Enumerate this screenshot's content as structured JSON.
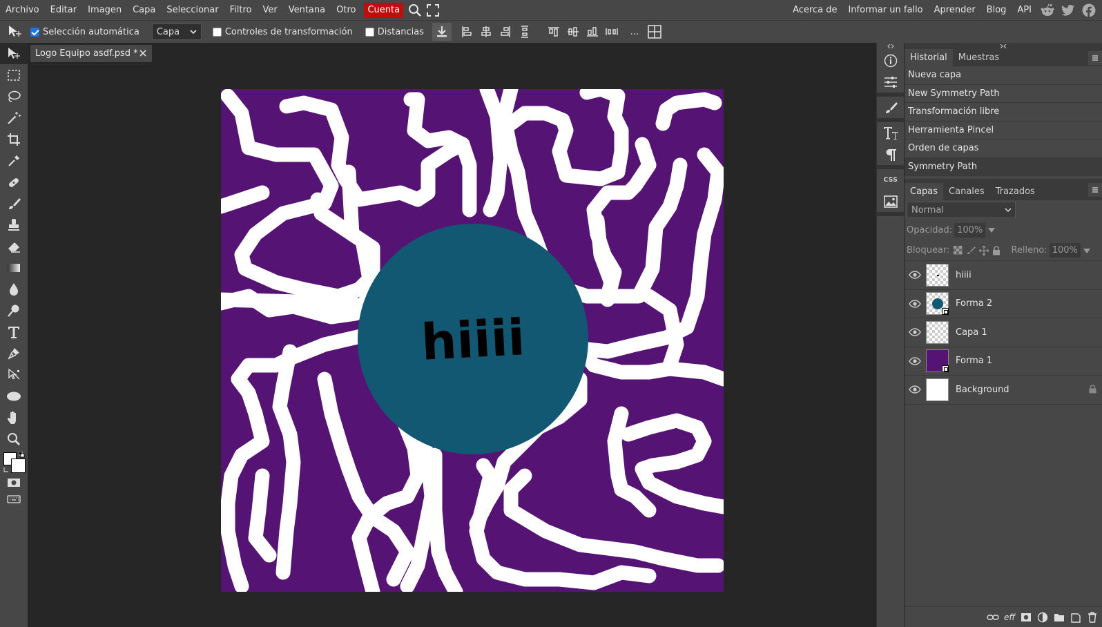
{
  "menu": {
    "items": [
      "Archivo",
      "Editar",
      "Imagen",
      "Capa",
      "Seleccionar",
      "Filtro",
      "Ver",
      "Ventana",
      "Otro"
    ],
    "account": "Cuenta",
    "right_links": [
      "Acerca de",
      "Informar un fallo",
      "Aprender",
      "Blog",
      "API"
    ]
  },
  "options": {
    "auto_select_label": "Selección automática",
    "auto_select_checked": true,
    "layer_select_value": "Capa",
    "transform_controls_label": "Controles de transformación",
    "distances_label": "Distancias",
    "more_label": "..."
  },
  "document": {
    "tab_name": "Logo Equipo asdf.psd *",
    "canvas_text": "hiiii",
    "colors": {
      "purple": "#551374",
      "teal": "#125873",
      "white": "#ffffff"
    }
  },
  "history": {
    "tabs": [
      "Historial",
      "Muestras"
    ],
    "items": [
      "Nueva capa",
      "New Symmetry Path",
      "Transformación libre",
      "Herramienta Pincel",
      "Orden de capas",
      "Symmetry Path"
    ]
  },
  "layers": {
    "tabs": [
      "Capas",
      "Canales",
      "Trazados"
    ],
    "blend_mode": "Normal",
    "opacity_label": "Opacidad:",
    "opacity_value": "100%",
    "lock_label": "Bloquear:",
    "fill_label": "Relleno:",
    "fill_value": "100%",
    "items": [
      {
        "name": "hiiii",
        "thumb": "transparent"
      },
      {
        "name": "Forma 2",
        "thumb": "circle"
      },
      {
        "name": "Capa 1",
        "thumb": "transparent"
      },
      {
        "name": "Forma 1",
        "thumb": "purple"
      },
      {
        "name": "Background",
        "thumb": "white"
      }
    ],
    "footer_eff": "eff"
  },
  "rightstrip": {
    "css_label": "CSS"
  }
}
